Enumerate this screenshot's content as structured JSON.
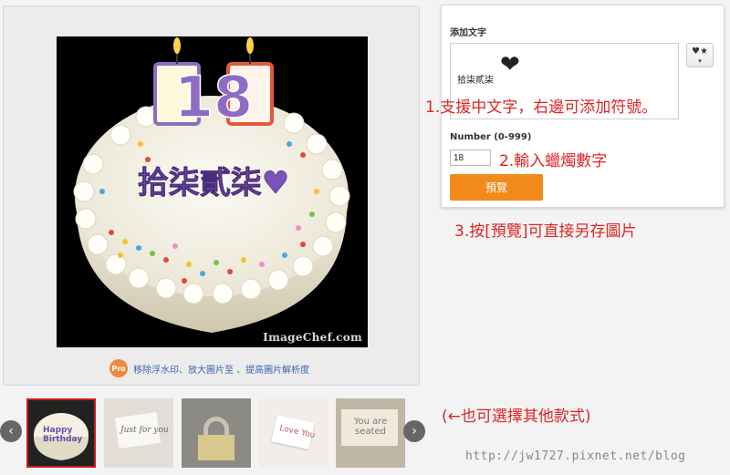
{
  "preview": {
    "cake_text": "拾柒貳柒♥",
    "candle_number": "18",
    "watermark": "ImageChef.com"
  },
  "pro": {
    "badge": "Pro",
    "link_text": "移除浮水印、放大圖片至 、提高圖片解析度"
  },
  "form": {
    "text_label": "添加文字",
    "text_value": "拾柒貳柒",
    "text_heart": "❤",
    "symbol_button": "♥★",
    "symbol_caret": "▾",
    "number_label": "Number (0-999)",
    "number_value": "18",
    "preview_button": "預覽"
  },
  "annotations": {
    "note1": "1.支援中文字，右邊可添加符號。",
    "note2": "2.輸入蠟燭數字",
    "note3": "3.按[預覽]可直接另存圖片",
    "note4": "(←也可選擇其他款式)"
  },
  "thumbnails": [
    {
      "name": "birthday-cake",
      "text": "Happy Birthday",
      "selected": true
    },
    {
      "name": "just-for-you-card",
      "text": "Just for you",
      "selected": false
    },
    {
      "name": "padlock",
      "text": "",
      "selected": false
    },
    {
      "name": "love-note",
      "text": "Love You",
      "selected": false
    },
    {
      "name": "you-are-seated-card",
      "text": "You are seated",
      "selected": false
    }
  ],
  "nav": {
    "prev": "‹",
    "next": "›"
  },
  "footer": {
    "url": "http://jw1727.pixnet.net/blog"
  },
  "colors": {
    "accent_orange": "#f28a1a",
    "annotation_red": "#e02424",
    "link_blue": "#3b64b0"
  }
}
